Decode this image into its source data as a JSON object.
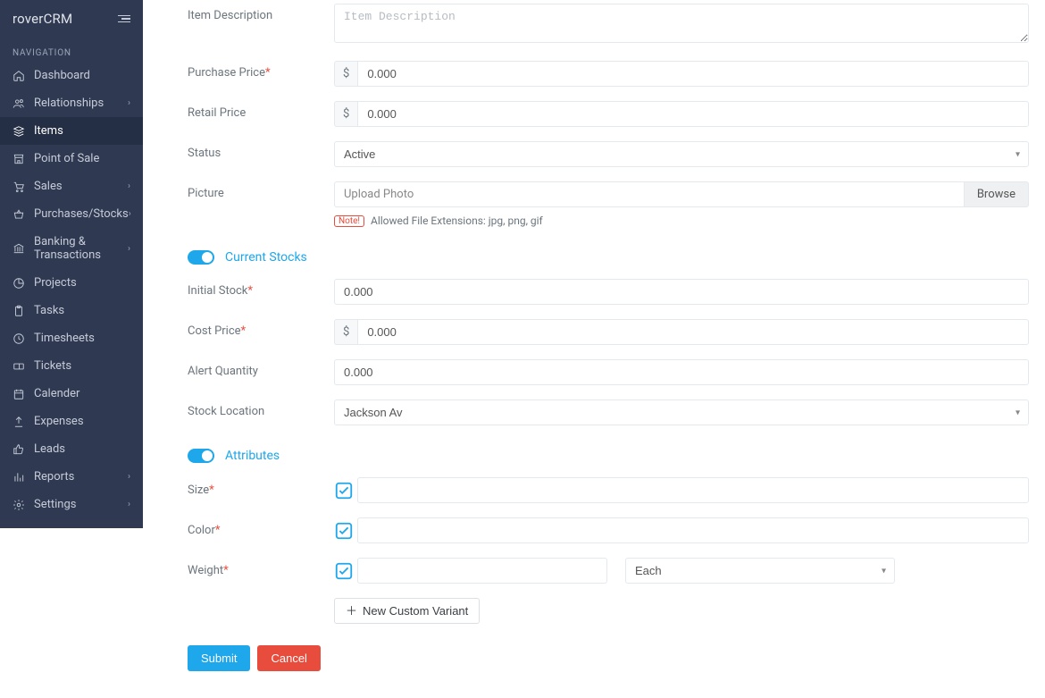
{
  "brand": "roverCRM",
  "nav_section": "NAVIGATION",
  "nav": [
    {
      "label": "Dashboard",
      "expandable": false
    },
    {
      "label": "Relationships",
      "expandable": true
    },
    {
      "label": "Items",
      "expandable": false,
      "active": true
    },
    {
      "label": "Point of Sale",
      "expandable": false
    },
    {
      "label": "Sales",
      "expandable": true
    },
    {
      "label": "Purchases/Stocks",
      "expandable": true
    },
    {
      "label": "Banking & Transactions",
      "expandable": true
    },
    {
      "label": "Projects",
      "expandable": false
    },
    {
      "label": "Tasks",
      "expandable": false
    },
    {
      "label": "Timesheets",
      "expandable": false
    },
    {
      "label": "Tickets",
      "expandable": false
    },
    {
      "label": "Calender",
      "expandable": false
    },
    {
      "label": "Expenses",
      "expandable": false
    },
    {
      "label": "Leads",
      "expandable": false
    },
    {
      "label": "Reports",
      "expandable": true
    },
    {
      "label": "Settings",
      "expandable": true
    }
  ],
  "form": {
    "item_description_label": "Item Description",
    "item_description_placeholder": "Item Description",
    "item_description_value": "",
    "purchase_price_label": "Purchase Price",
    "purchase_price_value": "0.000",
    "retail_price_label": "Retail Price",
    "retail_price_value": "0.000",
    "currency_symbol": "$",
    "status_label": "Status",
    "status_value": "Active",
    "picture_label": "Picture",
    "upload_placeholder": "Upload Photo",
    "browse_label": "Browse",
    "note_badge": "Note!",
    "note_text": "Allowed File Extensions: jpg, png, gif",
    "current_stocks_label": "Current Stocks",
    "initial_stock_label": "Initial Stock",
    "initial_stock_value": "0.000",
    "cost_price_label": "Cost Price",
    "cost_price_value": "0.000",
    "alert_qty_label": "Alert Quantity",
    "alert_qty_value": "0.000",
    "stock_location_label": "Stock Location",
    "stock_location_value": "Jackson Av",
    "attributes_label": "Attributes",
    "size_label": "Size",
    "size_value": "",
    "color_label": "Color",
    "color_value": "",
    "weight_label": "Weight",
    "weight_value": "",
    "weight_unit": "Each",
    "new_variant_label": "New Custom Variant",
    "submit_label": "Submit",
    "cancel_label": "Cancel"
  }
}
